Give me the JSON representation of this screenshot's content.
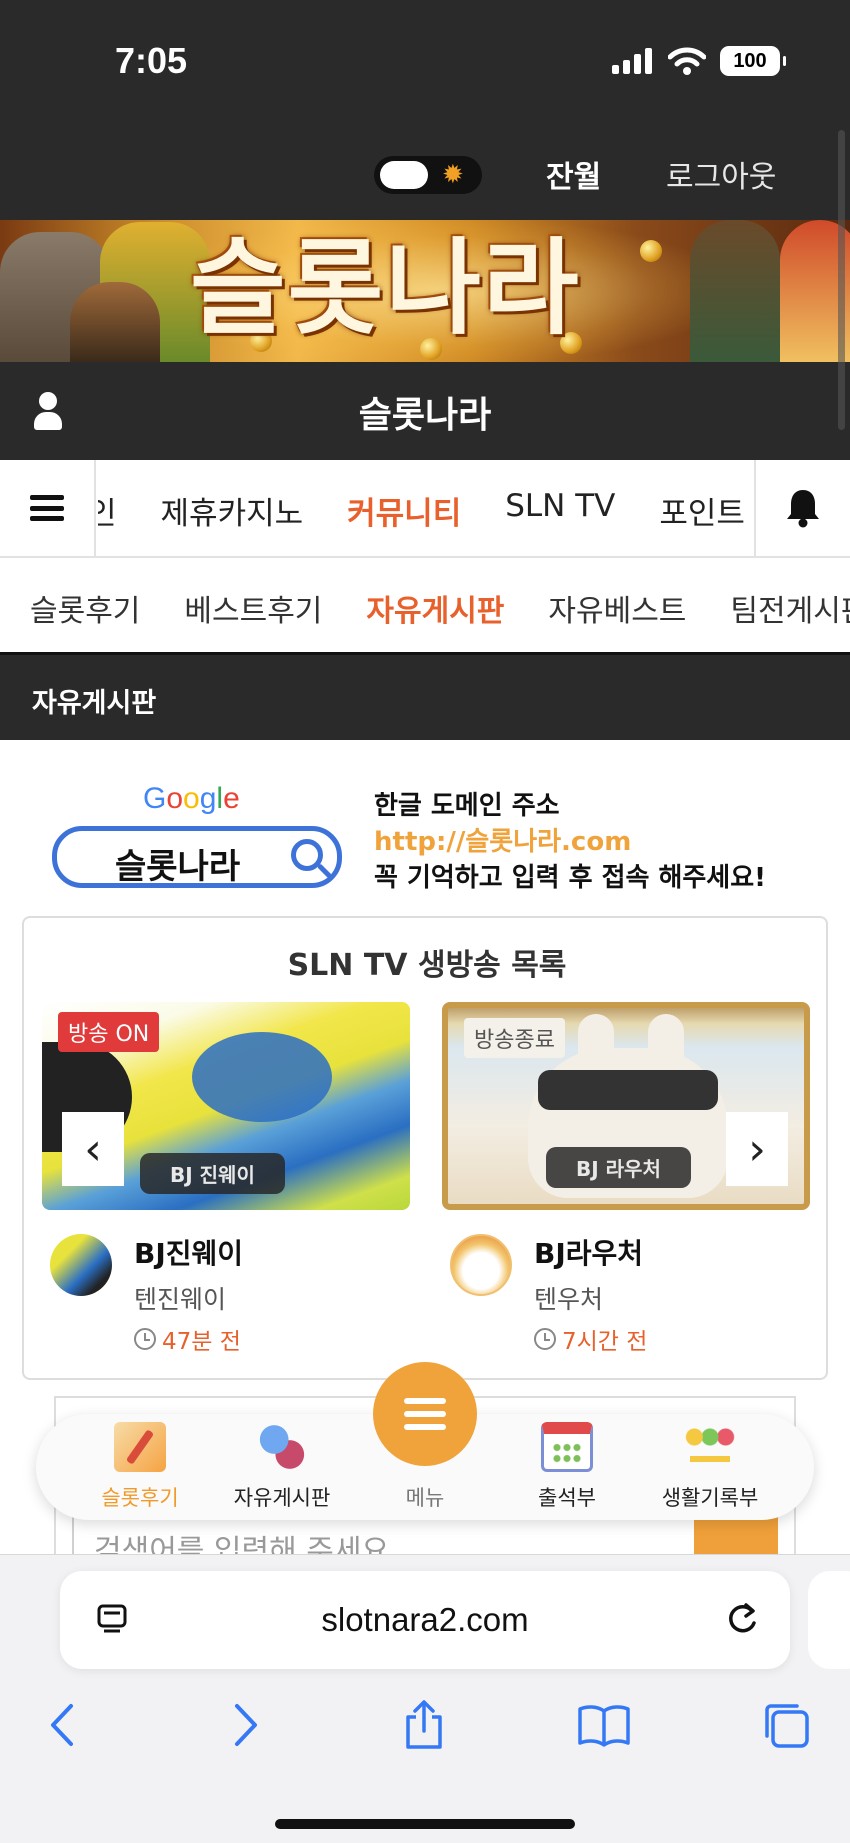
{
  "status_bar": {
    "time": "7:05",
    "battery": "100"
  },
  "header": {
    "balance_label": "잔월",
    "logout_label": "로그아웃"
  },
  "banner": {
    "text": "슬롯나라"
  },
  "site": {
    "title": "슬롯나라"
  },
  "main_nav": {
    "items": [
      "인",
      "제휴카지노",
      "커뮤니티",
      "SLN TV",
      "포인트"
    ],
    "active_index": 2
  },
  "sub_nav": {
    "items": [
      "슬롯후기",
      "베스트후기",
      "자유게시판",
      "자유베스트",
      "팀전게시판"
    ],
    "active_index": 2
  },
  "board": {
    "title": "자유게시판"
  },
  "domain_notice": {
    "google_word": "Google",
    "search_text": "슬롯나라",
    "line1": "한글 도메인 주소",
    "line2": "http://슬롯나라.com",
    "line3": "꼭 기억하고 입력 후 접속 해주세요!"
  },
  "live": {
    "title": "SLN TV 생방송 목록",
    "streams": [
      {
        "badge": "방송 ON",
        "thumb_label": "BJ 진웨이",
        "name": "BJ진웨이",
        "channel": "텐진웨이",
        "time": "47분 전"
      },
      {
        "badge": "방송종료",
        "thumb_label": "BJ 라우처",
        "name": "BJ라우처",
        "channel": "텐우처",
        "time": "7시간 전"
      }
    ]
  },
  "search": {
    "placeholder": "검색어를 입력해 주세요"
  },
  "bottom_menu": {
    "items": [
      {
        "label": "슬롯후기",
        "active": true
      },
      {
        "label": "자유게시판",
        "active": false
      },
      {
        "label": "메뉴",
        "active": false
      },
      {
        "label": "출석부",
        "active": false
      },
      {
        "label": "생활기록부",
        "active": false
      }
    ]
  },
  "browser": {
    "url": "slotnara2.com"
  },
  "colors": {
    "accent": "#e8612c",
    "orange": "#f0a23b",
    "dark": "#2a2a2b",
    "live_badge": "#e03a3a"
  }
}
